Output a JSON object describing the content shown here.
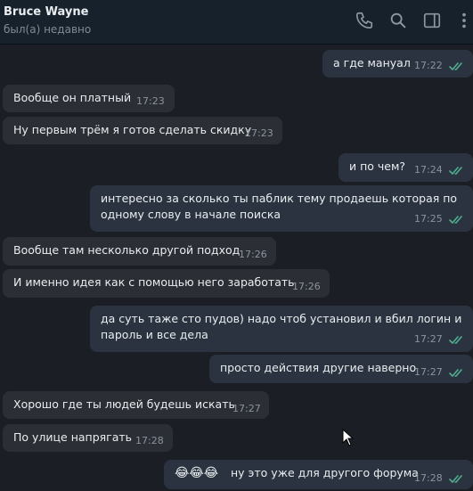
{
  "header": {
    "name": "Bruce Wayne",
    "status": "был(а) недавно"
  },
  "icons": {
    "call": "phone-icon",
    "search": "search-icon",
    "sidebar": "sidebar-toggle-icon",
    "more": "more-vertical-icon"
  },
  "colors": {
    "check": "#4fae8e"
  },
  "messages": [
    {
      "text": "а где мануал",
      "time": "17:22",
      "dir": "out"
    },
    {
      "text": "Вообще он платный",
      "time": "17:23",
      "dir": "in"
    },
    {
      "text": "Ну первым трём я готов сделать скидку",
      "time": "17:23",
      "dir": "in"
    },
    {
      "text": "и по чем?",
      "time": "17:24",
      "dir": "out"
    },
    {
      "line1": "интересно за сколько ты паблик тему продаешь которая по",
      "line2": "одному слову в начале поиска",
      "time": "17:25",
      "dir": "out"
    },
    {
      "text": "Вообще там несколько другой подход",
      "time": "17:26",
      "dir": "in"
    },
    {
      "text": "И именно идея как с помощью него заработать",
      "time": "17:26",
      "dir": "in"
    },
    {
      "line1": "да суть таже сто пудов) надо чтоб установил и вбил логин и",
      "line2": "пароль и все дела",
      "time": "17:27",
      "dir": "out"
    },
    {
      "text": "просто действия другие наверно",
      "time": "17:27",
      "dir": "out"
    },
    {
      "text": "Хорошо где ты людей будешь искать",
      "time": "17:27",
      "dir": "in"
    },
    {
      "text": "По улице напрягать",
      "time": "17:28",
      "dir": "in"
    },
    {
      "emoji": "😂😂😂",
      "text": "ну это уже для другого форума",
      "time": "17:28",
      "dir": "out"
    }
  ]
}
